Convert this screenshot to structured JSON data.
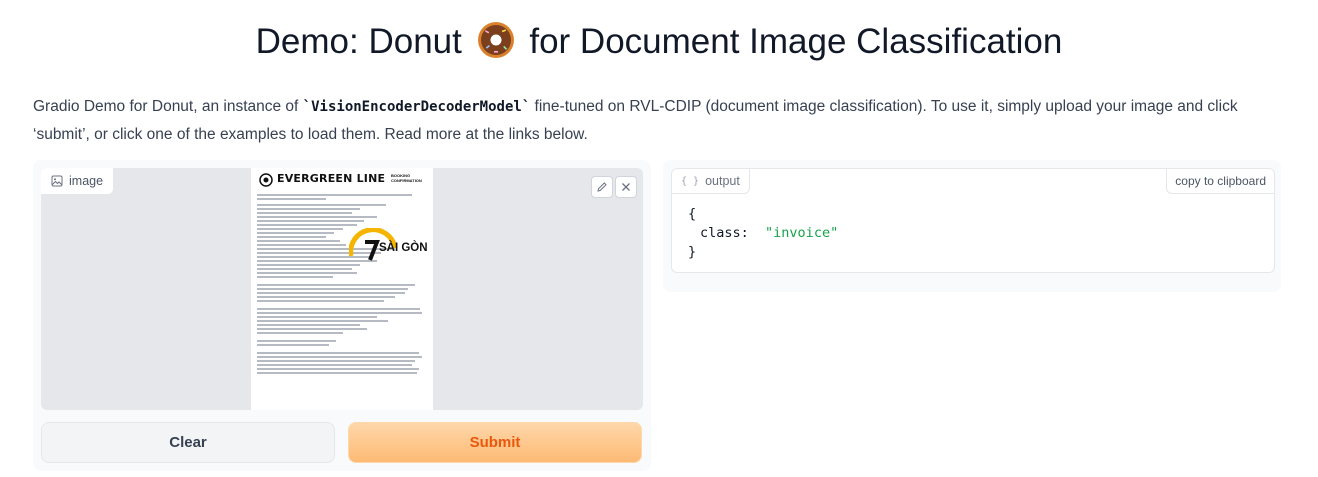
{
  "header": {
    "title_before": "Demo: Donut",
    "title_after": "for Document Image Classification"
  },
  "description": {
    "part1": "Gradio Demo for Donut, an instance of ",
    "code": "`VisionEncoderDecoderModel`",
    "part2": " fine-tuned on RVL-CDIP (document image classification). To use it, simply upload your image and click ‘submit’, or click one of the examples to load them. Read more at the links below."
  },
  "input": {
    "label": "image",
    "icon": "image-icon",
    "document": {
      "brand": "EVERGREEN LINE",
      "brand_sub": "BOOKING CONFIRMATION",
      "stamp_text": "SÀI GÒN"
    }
  },
  "buttons": {
    "clear": "Clear",
    "submit": "Submit"
  },
  "output": {
    "label": "output",
    "copy_label": "copy to clipboard",
    "open_brace": "{",
    "key": "class:",
    "value": "\"invoice\"",
    "close_brace": "}"
  },
  "colors": {
    "accent": "#ea580c",
    "submit_bg": "#fdba74",
    "json_string": "#16a34a"
  }
}
